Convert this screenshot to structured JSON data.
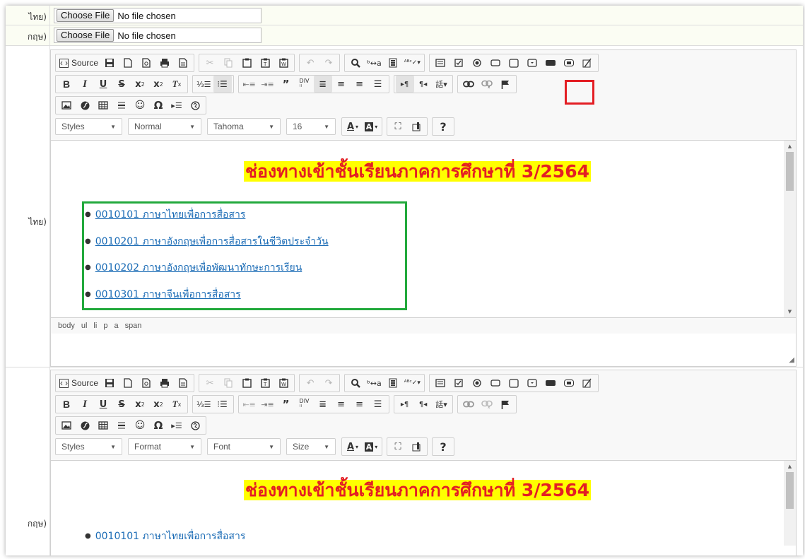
{
  "file_rows": [
    {
      "label": "ไทย)",
      "button": "Choose File",
      "status": "No file chosen"
    },
    {
      "label": "กฤษ)",
      "button": "Choose File",
      "status": "No file chosen"
    }
  ],
  "editors": [
    {
      "side_label": "ไทย)",
      "toolbar": {
        "source_label": "Source",
        "combos": [
          "Styles",
          "Normal",
          "Tahoma",
          "16"
        ]
      },
      "heading": "ช่องทางเข้าชั้นเรียนภาคการศึกษาที่ 3/2564",
      "courses": [
        "0010101 ภาษาไทยเพื่อการสื่อสาร",
        "0010201 ภาษาอังกฤษเพื่อการสื่อสารในชีวิตประจำวัน",
        "0010202 ภาษาอังกฤษเพื่อพัฒนาทักษะการเรียน",
        "0010301 ภาษาจีนเพื่อการสื่อสาร"
      ],
      "statusbar": [
        "body",
        "ul",
        "li",
        "p",
        "a",
        "span"
      ]
    },
    {
      "side_label": "กฤษ)",
      "toolbar": {
        "source_label": "Source",
        "combos": [
          "Styles",
          "Format",
          "Font",
          "Size"
        ]
      },
      "heading": "ช่องทางเข้าชั้นเรียนภาคการศึกษาที่ 3/2564",
      "courses": [
        "0010101 ภาษาไทยเพื่อการสื่อสาร"
      ]
    }
  ],
  "colors": {
    "highlight_red": "#e31e24",
    "highlight_green": "#22a93c",
    "heading_text": "#e31e24",
    "heading_bg": "#ffff00",
    "link": "#1a6bb5"
  },
  "icons": {
    "row1": [
      "source-icon",
      "save-icon",
      "new-page-icon",
      "preview-icon",
      "print-icon",
      "templates-icon",
      "cut-icon",
      "copy-icon",
      "paste-icon",
      "paste-text-icon",
      "paste-word-icon",
      "undo-icon",
      "redo-icon",
      "find-icon",
      "replace-icon",
      "select-all-icon",
      "spellcheck-icon",
      "form-icon",
      "checkbox-icon",
      "radio-icon",
      "textfield-icon",
      "textarea-icon",
      "select-icon",
      "button-icon",
      "image-button-icon",
      "hidden-field-icon"
    ],
    "row2": [
      "bold-icon",
      "italic-icon",
      "underline-icon",
      "strike-icon",
      "subscript-icon",
      "superscript-icon",
      "remove-format-icon",
      "numbered-list-icon",
      "bulleted-list-icon",
      "outdent-icon",
      "indent-icon",
      "blockquote-icon",
      "div-icon",
      "align-left-icon",
      "align-center-icon",
      "align-right-icon",
      "justify-icon",
      "ltr-icon",
      "rtl-icon",
      "language-icon",
      "link-icon",
      "unlink-icon",
      "anchor-icon"
    ],
    "row3": [
      "image-icon",
      "flash-icon",
      "table-icon",
      "horizontal-rule-icon",
      "smiley-icon",
      "special-char-icon",
      "page-break-icon",
      "iframe-icon"
    ],
    "row4": [
      "text-color-icon",
      "bg-color-icon",
      "maximize-icon",
      "show-blocks-icon",
      "about-icon"
    ]
  }
}
